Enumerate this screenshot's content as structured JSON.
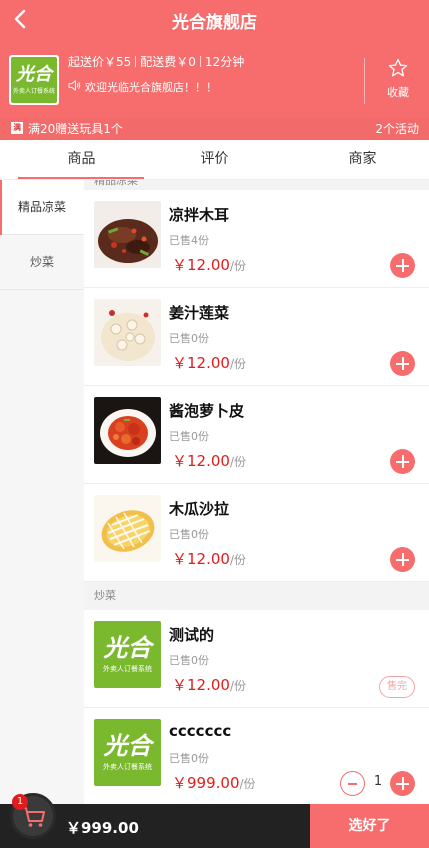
{
  "header": {
    "title": "光合旗舰店",
    "back_icon": "back-arrow-icon"
  },
  "shop": {
    "logo_text": "光合",
    "logo_subtext": "外卖人订餐系统",
    "min_order": "起送价￥55",
    "delivery_fee": "配送费￥0",
    "delivery_time": "12分钟",
    "notice": "欢迎光临光合旗舰店！！！",
    "favorite_label": "收藏"
  },
  "promo": {
    "tag": "满",
    "text": "满20赠送玩具1个",
    "activities": "2个活动"
  },
  "tabs": [
    {
      "label": "商品"
    },
    {
      "label": "评价"
    },
    {
      "label": "商家"
    }
  ],
  "categories": [
    {
      "label": "精品凉菜"
    },
    {
      "label": "炒菜"
    }
  ],
  "sections": {
    "partial_header": "精品凉菜",
    "stir_fry_header": "炒菜"
  },
  "products": [
    {
      "name": "凉拌木耳",
      "sold": "已售4份",
      "price": "￥12.00",
      "unit": "/份"
    },
    {
      "name": "姜汁莲菜",
      "sold": "已售0份",
      "price": "￥12.00",
      "unit": "/份"
    },
    {
      "name": "酱泡萝卜皮",
      "sold": "已售0份",
      "price": "￥12.00",
      "unit": "/份"
    },
    {
      "name": "木瓜沙拉",
      "sold": "已售0份",
      "price": "￥12.00",
      "unit": "/份"
    },
    {
      "name": "测试的",
      "sold": "已售0份",
      "price": "￥12.00",
      "unit": "/份",
      "status": "售完"
    },
    {
      "name": "ccccccc",
      "sold": "已售0份",
      "price": "￥999.00",
      "unit": "/份",
      "quantity": "1"
    }
  ],
  "cart": {
    "badge_count": "1",
    "total": "￥999.00",
    "checkout_label": "选好了"
  },
  "colors": {
    "brand": "#f76d6d",
    "price": "#e21b1b",
    "logo_green": "#7ab82e"
  }
}
